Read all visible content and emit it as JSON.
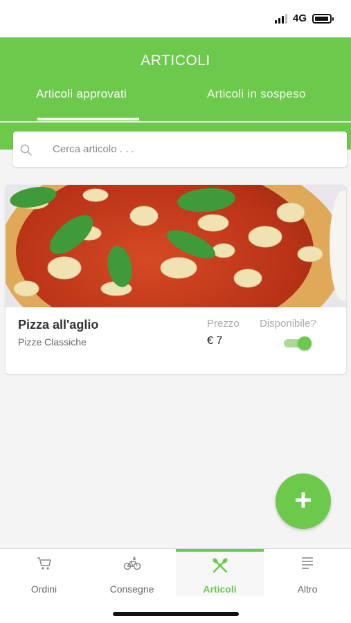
{
  "status_bar": {
    "network": "4G"
  },
  "header": {
    "title": "ARTICOLI",
    "tabs": [
      {
        "label": "Articoli approvati",
        "active": true
      },
      {
        "label": "Articoli in sospeso",
        "active": false
      }
    ]
  },
  "search": {
    "placeholder": "Cerca articolo . . ."
  },
  "items": [
    {
      "name": "Pizza all'aglio",
      "category": "Pizze Classiche",
      "price_label": "Prezzo",
      "price": "€ 7",
      "available_label": "Disponibile?",
      "available": true
    }
  ],
  "fab": {
    "label": "+"
  },
  "bottom_nav": [
    {
      "label": "Ordini",
      "icon": "cart-icon",
      "active": false
    },
    {
      "label": "Consegne",
      "icon": "bicycle-icon",
      "active": false
    },
    {
      "label": "Articoli",
      "icon": "fork-spoon-icon",
      "active": true
    },
    {
      "label": "Altro",
      "icon": "menu-lines-icon",
      "active": false
    }
  ],
  "colors": {
    "accent": "#6cc94b",
    "background": "#f4f4f4"
  }
}
